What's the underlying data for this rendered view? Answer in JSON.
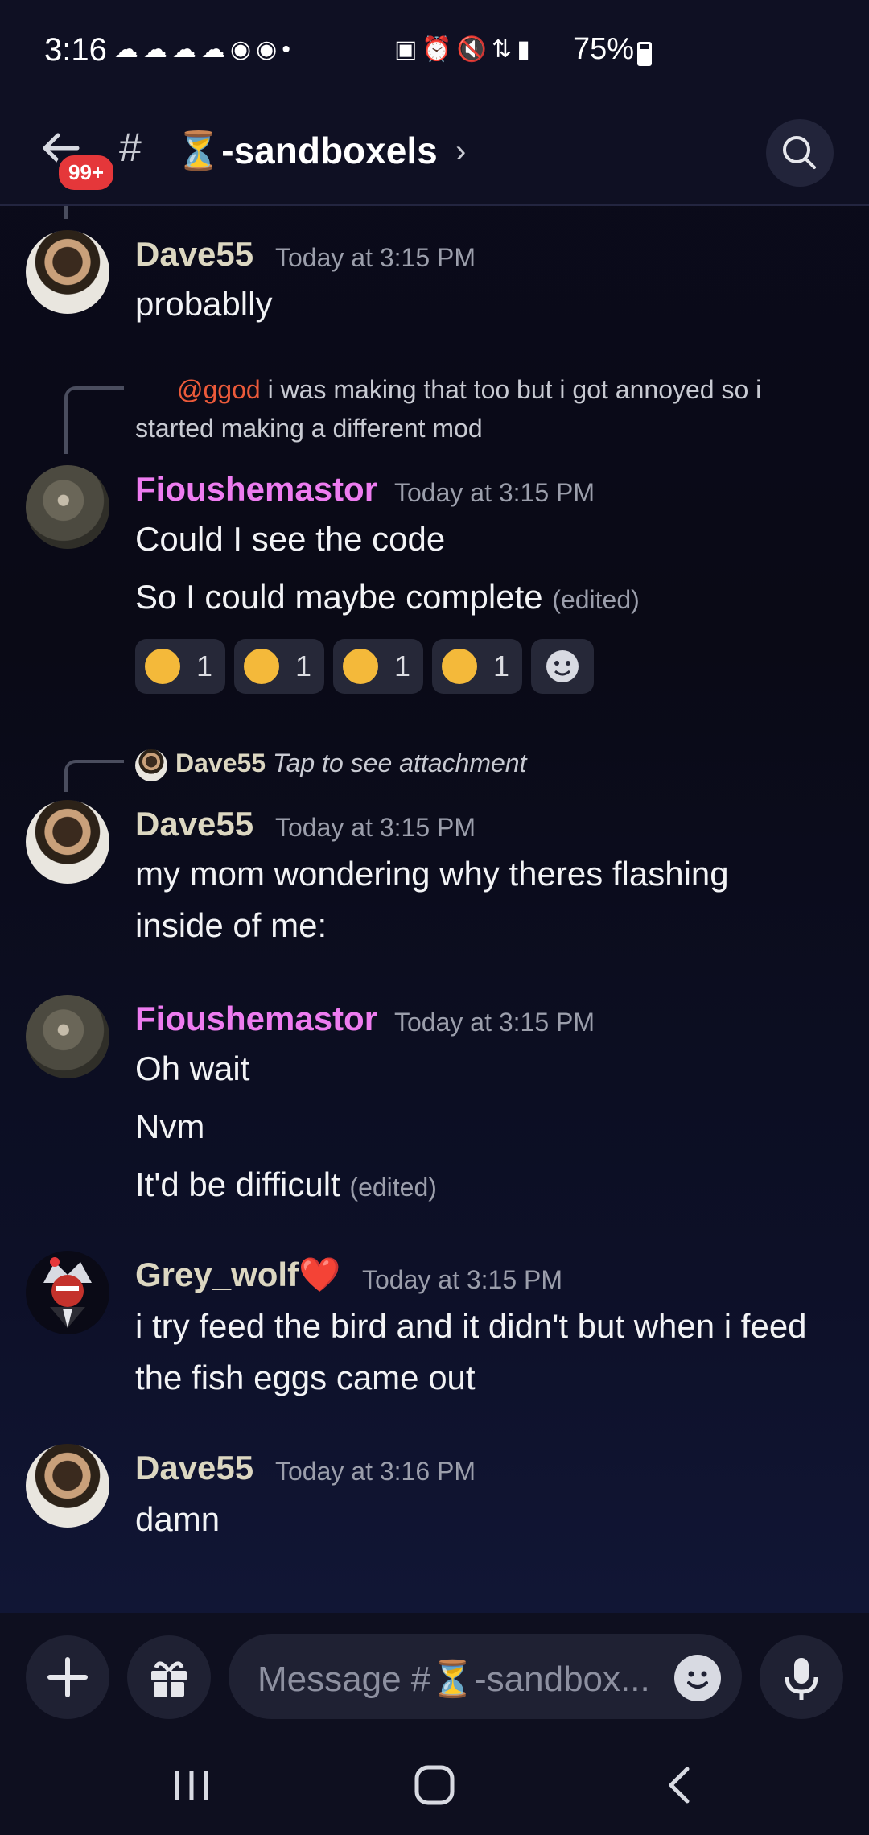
{
  "status_bar": {
    "time": "3:16",
    "battery": "75%",
    "left_icons": "☁☁☁☁◉◉•",
    "right_icons": "▣⏰🔇⇅▮"
  },
  "header": {
    "back_badge": "99+",
    "hash": "#",
    "channel_name": "⏳-sandboxels",
    "chevron": "›"
  },
  "messages": [
    {
      "author": "Dave55",
      "timestamp": "Today at 3:15 PM",
      "lines": [
        "probablly"
      ]
    },
    {
      "reply": {
        "mention": "@ggod",
        "text": " i was making that too but i got annoyed so i started making a different mod"
      },
      "author": "Fioushemastor",
      "timestamp": "Today at 3:15 PM",
      "lines": [
        "Could I see the code",
        "So I could maybe complete"
      ],
      "edited": "(edited)",
      "reactions": [
        {
          "emoji": "😈",
          "count": "1"
        },
        {
          "emoji": "☺",
          "count": "1"
        },
        {
          "emoji": "😏",
          "count": "1"
        },
        {
          "emoji": "😼",
          "count": "1"
        }
      ]
    },
    {
      "reply": {
        "author": "Dave55",
        "text": "Tap to see attachment"
      },
      "author": "Dave55",
      "timestamp": "Today at 3:15 PM",
      "lines": [
        "my mom wondering why theres flashing inside of me:"
      ]
    },
    {
      "author": "Fioushemastor",
      "timestamp": "Today at 3:15 PM",
      "lines": [
        "Oh wait",
        "Nvm",
        "It'd be difficult"
      ],
      "edited": "(edited)"
    },
    {
      "author": "Grey_wolf❤️",
      "timestamp": "Today at 3:15 PM",
      "lines": [
        "i try feed the bird and it didn't but when i feed the fish eggs came out"
      ]
    },
    {
      "author": "Dave55",
      "timestamp": "Today at 3:16 PM",
      "lines": [
        "damn"
      ]
    }
  ],
  "composer": {
    "placeholder": "Message #⏳-sandbox..."
  },
  "icons": {
    "back": "arrow-left-icon",
    "search": "search-icon",
    "add": "plus-icon",
    "gift": "gift-icon",
    "emoji": "emoji-icon",
    "mic": "microphone-icon",
    "nav_recents": "recents-icon",
    "nav_home": "home-icon",
    "nav_back": "nav-back-icon"
  },
  "colors": {
    "mention": "#ec5a3a",
    "fiou_name": "#ee7cf0",
    "dave_name": "#dcd7c1",
    "badge": "#e5373a"
  }
}
